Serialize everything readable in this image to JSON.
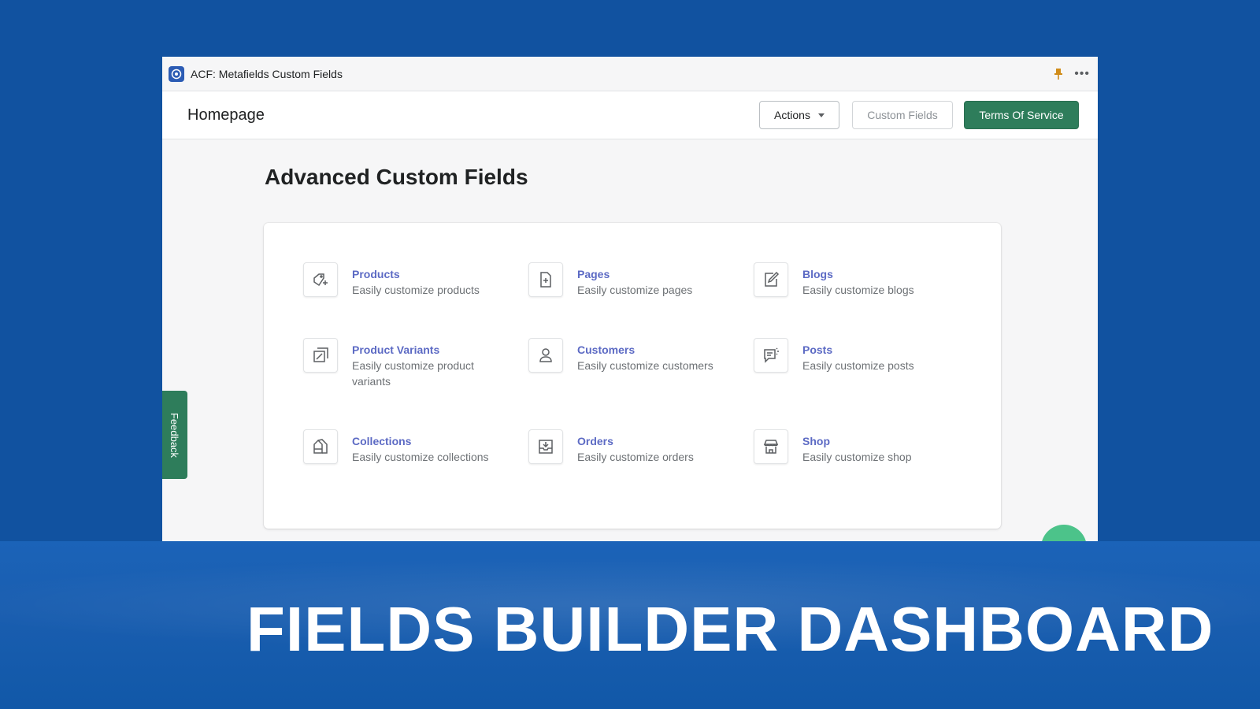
{
  "titlebar": {
    "app_icon": "acf-logo-icon",
    "app_title": "ACF: Metafields Custom Fields",
    "pin_icon": "pin-icon",
    "more_icon": "more-horizontal-icon"
  },
  "header": {
    "page_title": "Homepage",
    "actions_label": "Actions",
    "custom_fields_label": "Custom Fields",
    "terms_label": "Terms Of Service"
  },
  "main": {
    "heading": "Advanced Custom Fields",
    "tiles": [
      {
        "title": "Products",
        "description": "Easily customize products",
        "icon": "product-add-icon"
      },
      {
        "title": "Pages",
        "description": "Easily customize pages",
        "icon": "page-add-icon"
      },
      {
        "title": "Blogs",
        "description": "Easily customize blogs",
        "icon": "blog-edit-icon"
      },
      {
        "title": "Product Variants",
        "description": "Easily customize product variants",
        "icon": "variants-icon"
      },
      {
        "title": "Customers",
        "description": "Easily customize customers",
        "icon": "customer-icon"
      },
      {
        "title": "Posts",
        "description": "Easily customize posts",
        "icon": "posts-icon"
      },
      {
        "title": "Collections",
        "description": "Easily customize collections",
        "icon": "collections-icon"
      },
      {
        "title": "Orders",
        "description": "Easily customize orders",
        "icon": "orders-icon"
      },
      {
        "title": "Shop",
        "description": "Easily customize shop",
        "icon": "shop-icon"
      }
    ]
  },
  "feedback_label": "Feedback",
  "banner_text": "FIELDS BUILDER DASHBOARD",
  "colors": {
    "background": "#1152a0",
    "primary_green": "#2e7d5b",
    "link_indigo": "#5c6ac4",
    "fab_green": "#4cc38a"
  }
}
